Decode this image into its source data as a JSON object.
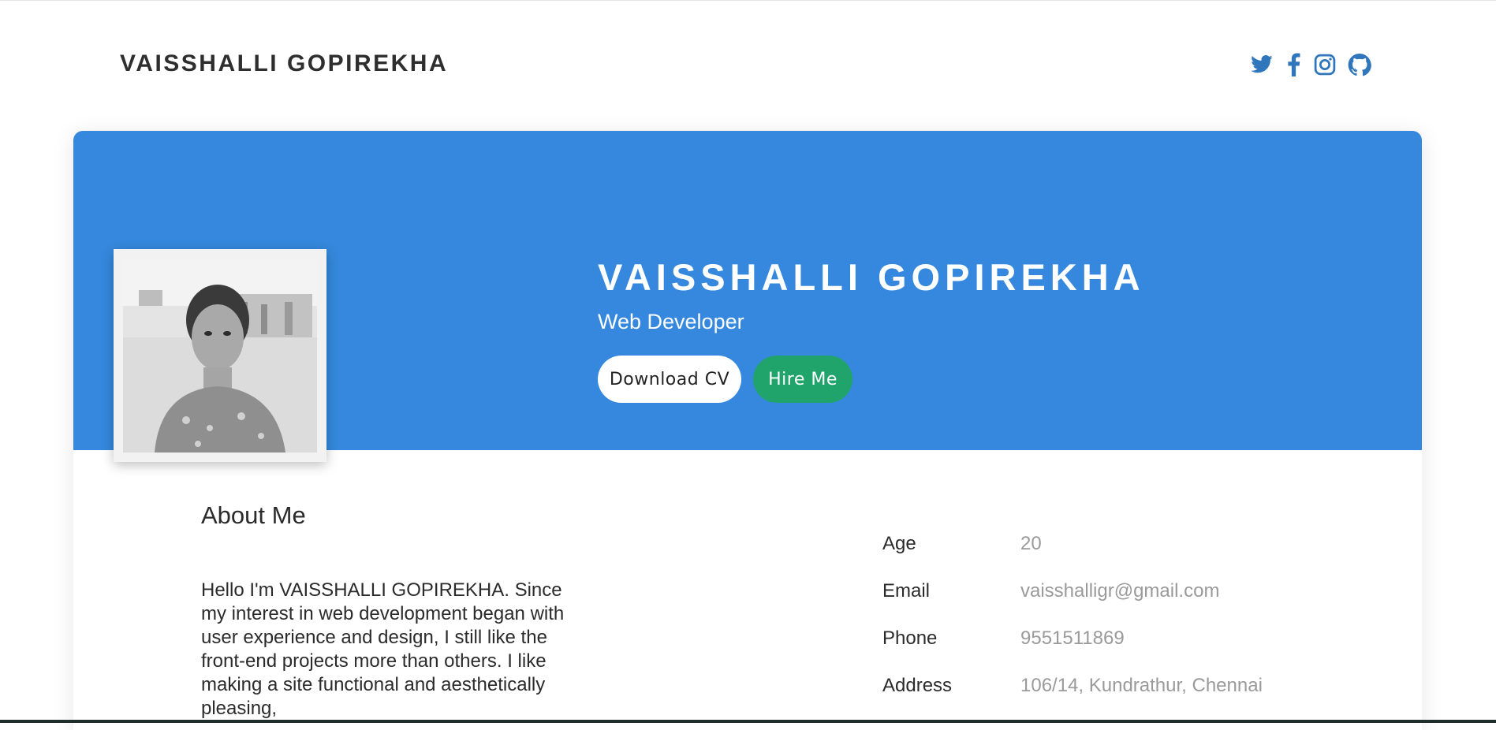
{
  "header": {
    "brand": "VAISSHALLI GOPIREKHA",
    "social_icons": [
      "twitter-icon",
      "facebook-icon",
      "instagram-icon",
      "github-icon"
    ],
    "icon_color": "#3076bd"
  },
  "hero": {
    "name": "VAISSHALLI GOPIREKHA",
    "role": "Web Developer",
    "download_cv_label": "Download CV",
    "hire_me_label": "Hire Me",
    "banner_color": "#3588dd",
    "hire_color": "#21a46b"
  },
  "about": {
    "title": "About Me",
    "text": "Hello I'm VAISSHALLI GOPIREKHA. Since my interest in web development began with user experience and design, I still like the front-end projects more than others. I like making a site functional and aesthetically pleasing,"
  },
  "info": [
    {
      "label": "Age",
      "value": "20"
    },
    {
      "label": "Email",
      "value": "vaisshalligr@gmail.com"
    },
    {
      "label": "Phone",
      "value": "9551511869"
    },
    {
      "label": "Address",
      "value": "106/14, Kundrathur, Chennai"
    }
  ]
}
